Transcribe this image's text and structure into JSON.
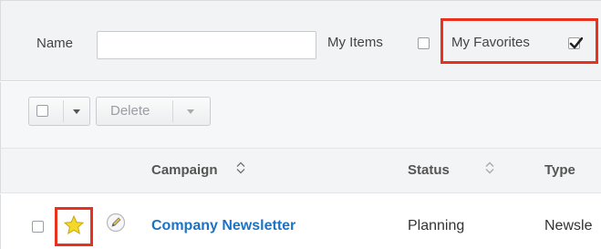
{
  "filter": {
    "name_label": "Name",
    "name_value": "",
    "my_items_label": "My Items",
    "my_favorites_label": "My Favorites",
    "my_items_checked": false,
    "my_favorites_checked": true
  },
  "actions": {
    "delete_label": "Delete"
  },
  "columns": [
    {
      "label": "Campaign",
      "sortable": true
    },
    {
      "label": "Status",
      "sortable": true
    },
    {
      "label": "Type",
      "sortable": false
    }
  ],
  "rows": [
    {
      "campaign": "Company Newsletter",
      "status": "Planning",
      "type": "Newsle",
      "favorite": true
    }
  ],
  "colors": {
    "highlight": "#e8321e",
    "link": "#1c72c4",
    "star": "#f4d82a"
  },
  "icons": {
    "favorite": "star-icon",
    "edit": "pencil-icon",
    "sort": "sort-arrows-icon",
    "dropdown": "caret-down-icon"
  }
}
